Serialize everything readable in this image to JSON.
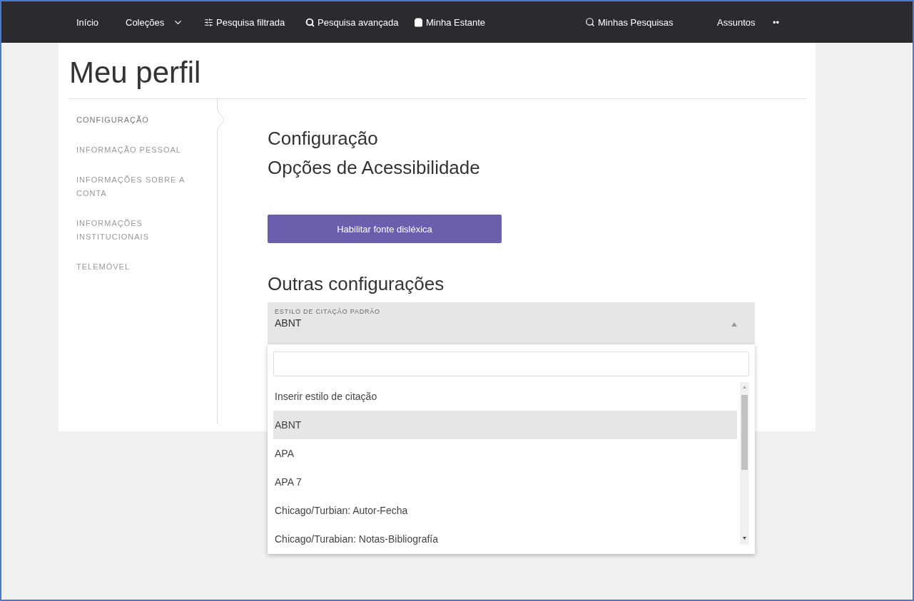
{
  "nav": [
    {
      "label": "Início",
      "kind": "plain"
    },
    {
      "label": "Coleções",
      "kind": "menu"
    },
    {
      "label": "Pesquisa filtrada",
      "kind": "filter"
    },
    {
      "label": "Pesquisa avançada",
      "kind": "advanced"
    },
    {
      "label": "Minha Estante",
      "kind": "shelf"
    },
    {
      "label": "Minhas Pesquisas",
      "kind": "searches"
    },
    {
      "label": "Assuntos",
      "kind": "plain"
    },
    {
      "label": "••",
      "kind": "plain"
    }
  ],
  "page_title": "Meu perfil",
  "sidebar": {
    "items": [
      {
        "label": "CONFIGURAÇÃO",
        "selected": true
      },
      {
        "label": "INFORMAÇÃO PESSOAL",
        "selected": false
      },
      {
        "label": "INFORMAÇÕES SOBRE A CONTA",
        "selected": false
      },
      {
        "label": "INFORMAÇÕES INSTITUCIONAIS",
        "selected": false
      },
      {
        "label": "TELEMÓVEL",
        "selected": false
      }
    ]
  },
  "section_title": "Configuração",
  "accessibility": {
    "heading": "Opções de Acessibilidade",
    "button": "Habilitar fonte disléxica"
  },
  "other": {
    "heading": "Outras configurações",
    "select": {
      "label": "ESTILO DE CITAÇÃO PADRÃO",
      "value": "ABNT",
      "expanded": true,
      "options": [
        {
          "label": "Inserir estilo de citação",
          "selected": false
        },
        {
          "label": "ABNT",
          "selected": true
        },
        {
          "label": "APA",
          "selected": false
        },
        {
          "label": "APA 7",
          "selected": false
        },
        {
          "label": "Chicago/Turbian: Autor-Fecha",
          "selected": false
        },
        {
          "label": "Chicago/Turabian: Notas-Bibliografía",
          "selected": false
        }
      ]
    }
  }
}
